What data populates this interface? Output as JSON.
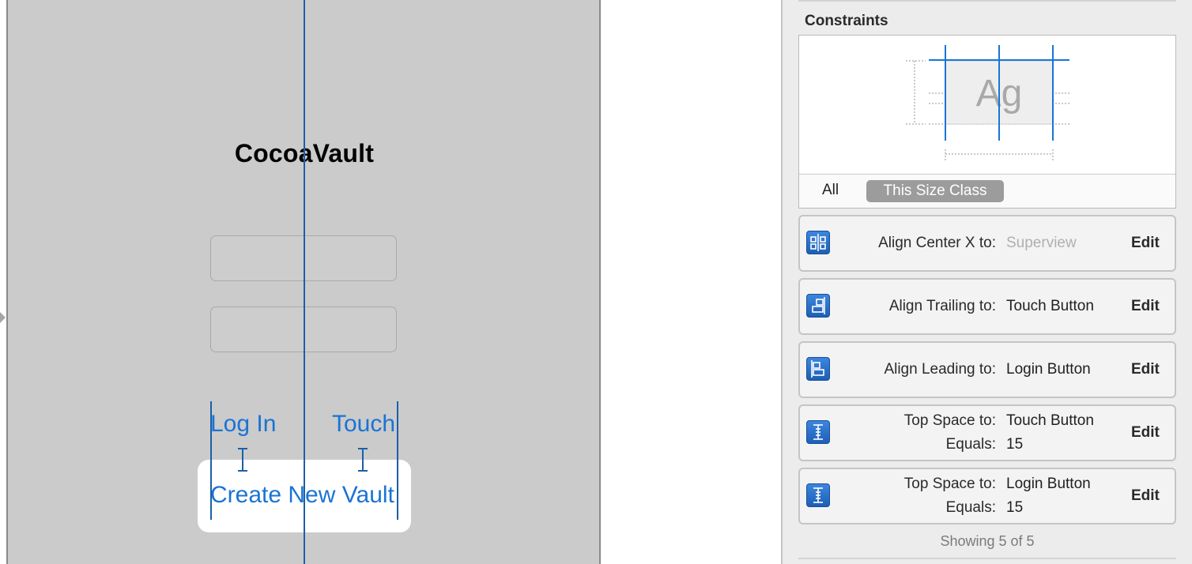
{
  "canvas": {
    "app_title": "CocoaVault",
    "buttons": {
      "login": "Log In",
      "touch": "Touch",
      "create": "Create New Vault"
    }
  },
  "inspector": {
    "section_title": "Constraints",
    "preview": {
      "sample_text": "Ag",
      "tabs": [
        "All",
        "This Size Class"
      ],
      "selected_tab": "This Size Class"
    },
    "constraints": [
      {
        "label": "Align Center X to:",
        "value": "Superview",
        "value_muted": true,
        "edit": "Edit",
        "icon": "align-center-x-icon"
      },
      {
        "label": "Align Trailing to:",
        "value": "Touch Button",
        "edit": "Edit",
        "icon": "align-trailing-icon"
      },
      {
        "label": "Align Leading to:",
        "value": "Login Button",
        "edit": "Edit",
        "icon": "align-leading-icon"
      },
      {
        "label": "Top Space to:",
        "value": "Touch Button",
        "label2": "Equals:",
        "value2": "15",
        "edit": "Edit",
        "icon": "top-space-icon"
      },
      {
        "label": "Top Space to:",
        "value": "Login Button",
        "label2": "Equals:",
        "value2": "15",
        "edit": "Edit",
        "icon": "top-space-icon"
      }
    ],
    "showing": "Showing 5 of 5"
  },
  "colors": {
    "accent_blue": "#1a73d4",
    "guide_blue": "#1c5fa8",
    "scene_gray": "#cbcbcb",
    "inspector_bg": "#ececec"
  }
}
